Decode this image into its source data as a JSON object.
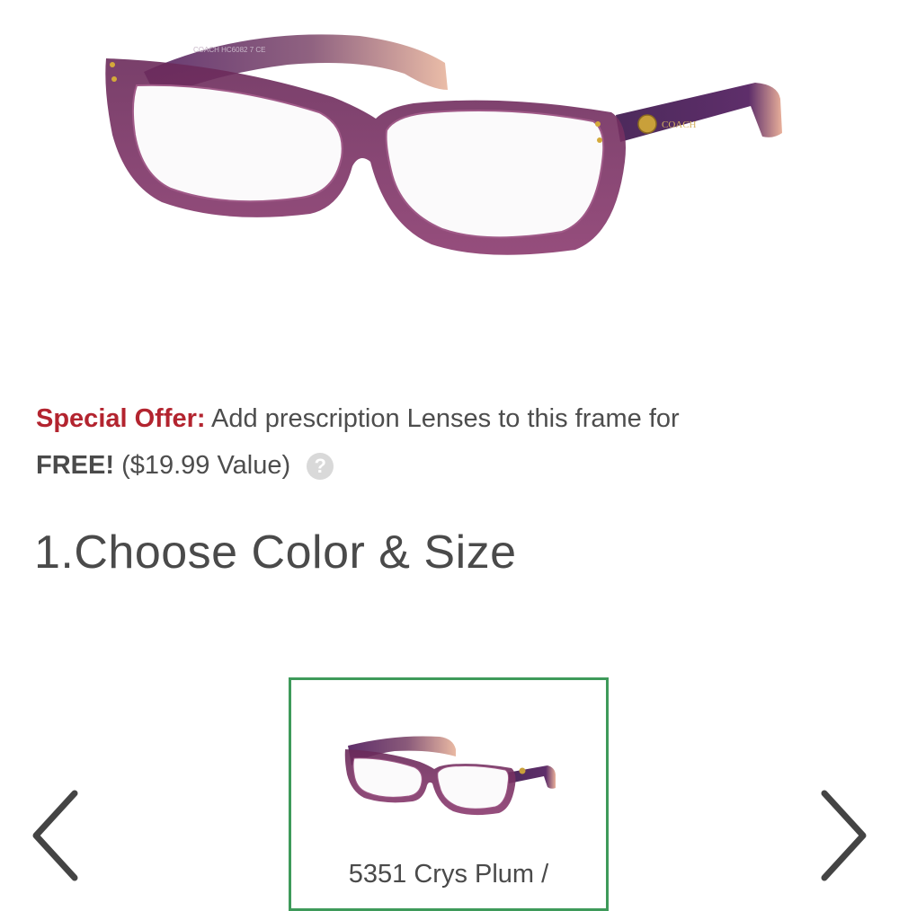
{
  "product": {
    "brand_mark": "COACH",
    "temple_print": "COACH  HC6082  7  CE"
  },
  "offer": {
    "label": "Special Offer:",
    "text": "Add prescription Lenses to this frame for",
    "free": "FREE!",
    "value": "($19.99 Value)",
    "help_icon": "question-circle-icon"
  },
  "step": {
    "title": "1.Choose Color & Size"
  },
  "carousel": {
    "prev_icon": "chevron-left-icon",
    "next_icon": "chevron-right-icon",
    "selected": {
      "label": "5351 Crys Plum /"
    }
  },
  "colors": {
    "special_offer": "#b3242f",
    "selected_border": "#3e9a5a",
    "frame_plum": "#7a2d5e"
  }
}
